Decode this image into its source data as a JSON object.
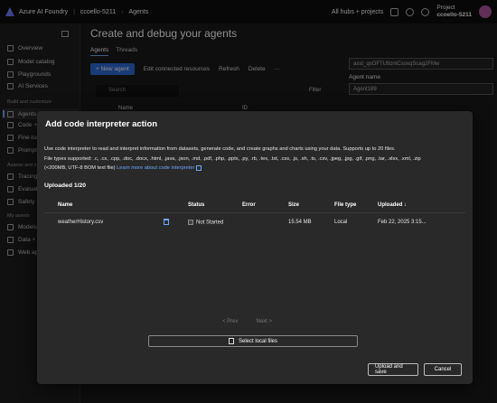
{
  "topbar": {
    "app_name": "Azure AI Foundry",
    "crumb_1": "ccoello-5211",
    "crumb_2": "Agents",
    "hubs": "All hubs + projects",
    "project_label": "Project",
    "project_name": "ccoello-5211"
  },
  "sidebar": {
    "items": [
      {
        "label": "Overview"
      },
      {
        "label": "Model catalog"
      },
      {
        "label": "Playgrounds"
      },
      {
        "label": "AI Services"
      },
      {
        "label": "Agents"
      },
      {
        "label": "Code +"
      },
      {
        "label": "Fine-tun"
      },
      {
        "label": "Prompt"
      },
      {
        "label": "Tracing"
      },
      {
        "label": "Evaluati"
      },
      {
        "label": "Safety +"
      },
      {
        "label": "Models"
      },
      {
        "label": "Data +"
      },
      {
        "label": "Web app"
      }
    ],
    "section_build": "Build and customize",
    "section_assess": "Assess and im",
    "section_assets": "My assets"
  },
  "main": {
    "title": "Create and debug your agents",
    "tab_agents": "Agents",
    "tab_threads": "Threads",
    "new_agent": "+ New agent",
    "edit_resources": "Edit connected resources",
    "refresh": "Refresh",
    "delete": "Delete",
    "search_placeholder": "Search",
    "filter": "Filter",
    "col_name": "Name",
    "col_id": "ID"
  },
  "right_panel": {
    "agent_id": "asst_qsOFTU9zntCsoxqScag2FMw",
    "agent_name_label": "Agent name",
    "agent_name_value": "Agent189"
  },
  "dialog": {
    "title": "Add code interpreter action",
    "desc_line1": "Use code interpreter to read and interpret information from datasets, generate code, and create graphs and charts using your data. Supports up to 20 files.",
    "desc_line2": "File types supported: .c, .cs, .cpp, .doc, .docx, .html, .java, .json, .md, .pdf, .php, .pptx, .py, .rb, .tex, .txt, .css, .js, .sh, .ts, .csv, .jpeg, .jpg, .gif, .png, .tar, .xlsx, .xml, .zip",
    "desc_line3": "(<200MB, UTF-8 BOM text file)",
    "learn_more": "Learn more about code interpreter",
    "uploaded": "Uploaded 1/20",
    "columns": [
      "Name",
      "Status",
      "Error",
      "Size",
      "File type",
      "Uploaded ↓"
    ],
    "rows": [
      {
        "name": "weatherHistory.csv",
        "status": "Not Started",
        "error": "",
        "size": "15.54 MB",
        "type": "Local",
        "uploaded": "Feb 22, 2025 3:15..."
      }
    ],
    "prev": "< Prev",
    "next": "Next >",
    "select_files": "Select local files",
    "upload_save": "Upload and save",
    "cancel": "Cancel"
  }
}
